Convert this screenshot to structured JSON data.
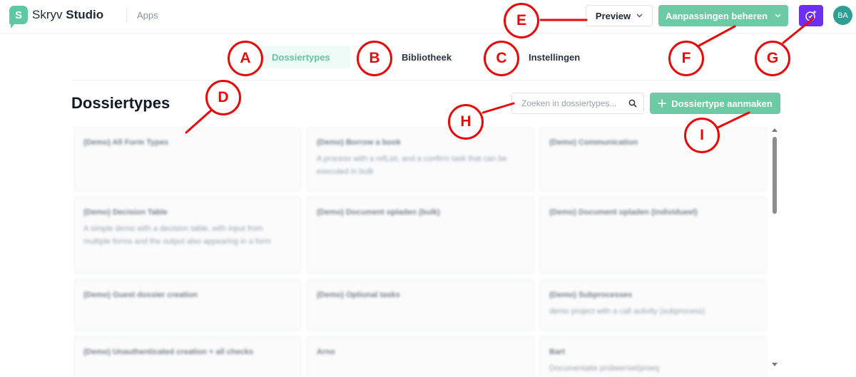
{
  "header": {
    "logo_letter": "S",
    "brand_light": "Skryv ",
    "brand_bold": "Studio",
    "apps_label": "Apps",
    "preview_label": "Preview",
    "manage_label": "Aanpassingen beheren",
    "avatar_initials": "BA"
  },
  "tabs": [
    {
      "label": "Dossiertypes",
      "active": true
    },
    {
      "label": "Bibliotheek",
      "active": false
    },
    {
      "label": "Instellingen",
      "active": false
    }
  ],
  "page": {
    "title": "Dossiertypes",
    "search_placeholder": "Zoeken in dossiertypes...",
    "create_label": "Dossiertype aanmaken"
  },
  "cards": [
    {
      "title": "(Demo) All Form Types",
      "desc": ""
    },
    {
      "title": "(Demo) Borrow a book",
      "desc": "A process with a refList, and a confirm task that can be executed in bulk"
    },
    {
      "title": "(Demo) Communication",
      "desc": ""
    },
    {
      "title": "(Demo) Decision Table",
      "desc": "A simple demo with a decision table, with input from multiple forms and the output also appearing in a form"
    },
    {
      "title": "(Demo) Document opladen (bulk)",
      "desc": ""
    },
    {
      "title": "(Demo) Document opladen (individueel)",
      "desc": ""
    },
    {
      "title": "(Demo) Guest dossier creation",
      "desc": ""
    },
    {
      "title": "(Demo) Optional tasks",
      "desc": ""
    },
    {
      "title": "(Demo) Subprocesses",
      "desc": "demo project with a call activity (subprocess)"
    },
    {
      "title": "(Demo) Unauthenticated creation + all checks",
      "desc": ""
    },
    {
      "title": "Arno",
      "desc": ""
    },
    {
      "title": "Bart",
      "desc": "Documentatie probeersel/proeq"
    }
  ],
  "annotations": [
    "A",
    "B",
    "C",
    "D",
    "E",
    "F",
    "G",
    "H",
    "I"
  ],
  "colors": {
    "brand_green": "#5ec8a0",
    "button_green": "#6ccba4",
    "ai_purple": "#6d2ff2",
    "avatar_teal": "#2f9e93",
    "annotation_red": "#e60b0b"
  },
  "icons": {
    "preview_chevron": "chevron-down-icon",
    "manage_chevron": "chevron-down-icon",
    "ai_button": "sparkle-icon",
    "search": "search-icon",
    "create": "plus-icon"
  }
}
